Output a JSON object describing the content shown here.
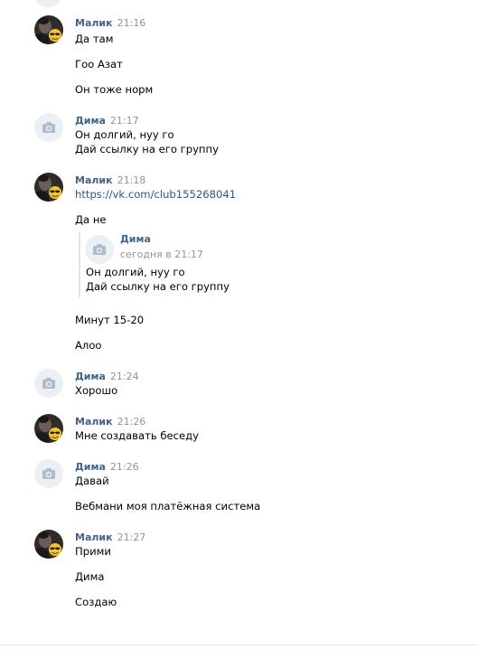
{
  "messages": [
    {
      "author": "Малик",
      "time": "21:16",
      "avatar_icon": "user-photo-icon",
      "lines": [
        "Да там",
        "Гоо Азат",
        "Он тоже норм"
      ]
    },
    {
      "author": "Дима",
      "time": "21:17",
      "avatar_icon": "camera-icon",
      "lines": [
        "Он долгий, нуу го",
        "Дай ссылку на его группу"
      ]
    },
    {
      "author": "Малик",
      "time": "21:18",
      "avatar_icon": "user-photo-icon",
      "lines": [
        "https://vk.com/club155268041",
        "Да не",
        "Минут 15-20",
        "Алоо"
      ],
      "quote": {
        "author": "Дима",
        "time": "сегодня в 21:17",
        "avatar_icon": "camera-icon",
        "lines": [
          "Он долгий, нуу го",
          "Дай ссылку на его группу"
        ]
      }
    },
    {
      "author": "Дима",
      "time": "21:24",
      "avatar_icon": "camera-icon",
      "lines": [
        "Хорошо"
      ]
    },
    {
      "author": "Малик",
      "time": "21:26",
      "avatar_icon": "user-photo-icon",
      "lines": [
        "Мне создавать беседу"
      ]
    },
    {
      "author": "Дима",
      "time": "21:26",
      "avatar_icon": "camera-icon",
      "lines": [
        "Давай",
        "Вебмани моя платёжная система"
      ]
    },
    {
      "author": "Малик",
      "time": "21:27",
      "avatar_icon": "user-photo-icon",
      "lines": [
        "Прими",
        "Дима",
        "Создаю"
      ]
    }
  ],
  "colors": {
    "author_name": "#42648b",
    "time": "#939393",
    "link": "#2a5885",
    "placeholder_bg": "#ecf0f3",
    "quote_border": "#dfe6ee"
  }
}
